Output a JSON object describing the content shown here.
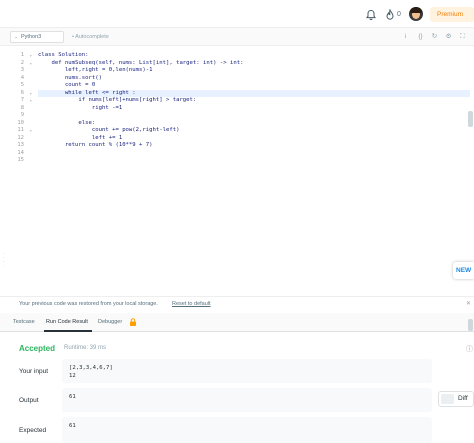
{
  "header": {
    "fire_count": "0",
    "premium_label": "Premium"
  },
  "toolbar": {
    "language": "Python3",
    "autocomplete_label": "Autocomplete"
  },
  "editor": {
    "line_numbers": [
      "1",
      "2",
      "3",
      "4",
      "5",
      "6",
      "7",
      "8",
      "9",
      "10",
      "11",
      "12",
      "13",
      "14",
      "15"
    ],
    "fold_lines": [
      1,
      2,
      6,
      7,
      11
    ],
    "active_line": 6,
    "lines": [
      "class Solution:",
      "    def numSubseq(self, nums: List[int], target: int) -> int:",
      "        left,right = 0,len(nums)-1",
      "        nums.sort()",
      "        count = 0",
      "        while left <= right :",
      "            if nums[left]+nums[right] > target:",
      "                right -=1",
      "",
      "            else:",
      "                count += pow(2,right-left)",
      "                left += 1",
      "        return count % (10**9 + 7)",
      "",
      ""
    ],
    "new_badge": "NEW"
  },
  "restore": {
    "message": "Your previous code was restored from your local storage.",
    "reset_link": "Reset to default"
  },
  "tabs": [
    {
      "label": "Testcase"
    },
    {
      "label": "Run Code Result"
    },
    {
      "label": "Debugger"
    }
  ],
  "result": {
    "status": "Accepted",
    "runtime": "Runtime: 39 ms",
    "your_input_label": "Your input",
    "your_input_lines": [
      "[2,3,3,4,6,7]",
      "12"
    ],
    "output_label": "Output",
    "output_value": "61",
    "diff_label": "Diff",
    "expected_label": "Expected",
    "expected_value": "61"
  },
  "colors": {
    "accepted": "#2db55d",
    "premium_text": "#f57c00",
    "premium_bg": "#fff3e0",
    "new_badge": "#1e88e5"
  }
}
